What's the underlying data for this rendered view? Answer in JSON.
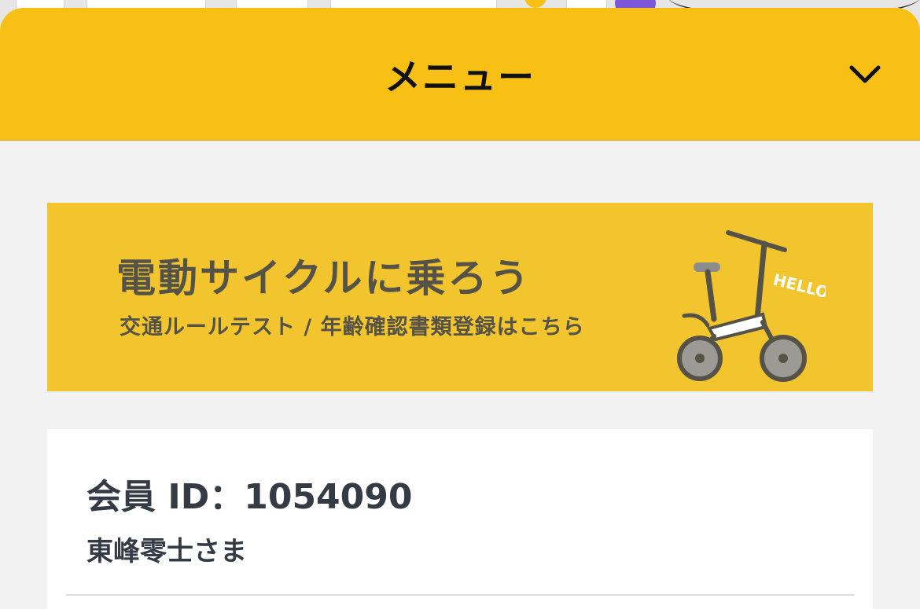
{
  "menu": {
    "title": "メニュー",
    "collapse_icon": "chevron-down-icon"
  },
  "banner": {
    "title": "電動サイクルに乗ろう",
    "subtitle": "交通ルールテスト / 年齢確認書類登録はこちら",
    "illustration_text": "HELLO!",
    "background_color": "#f2c42e"
  },
  "member": {
    "id_label": "会員 ID：1054090",
    "name": "東峰零士さま"
  },
  "colors": {
    "header": "#f8c015",
    "sheet_background": "#f2f2f2",
    "text_dark": "#353b45"
  }
}
